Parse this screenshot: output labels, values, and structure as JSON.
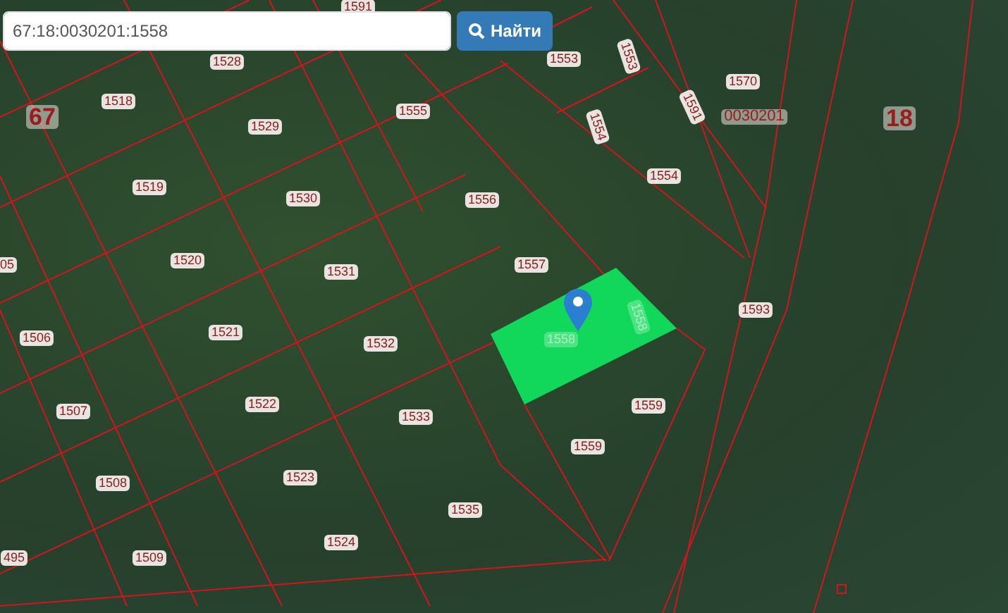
{
  "search": {
    "value": "67:18:0030201:1558",
    "button": "Найти"
  },
  "map_labels": [
    {
      "text": "1591",
      "kind": "parcel"
    },
    {
      "text": "1528",
      "kind": "parcel"
    },
    {
      "text": "67",
      "kind": "district"
    },
    {
      "text": "1518",
      "kind": "parcel"
    },
    {
      "text": "1529",
      "kind": "parcel"
    },
    {
      "text": "1555",
      "kind": "parcel"
    },
    {
      "text": "1553",
      "kind": "parcel"
    },
    {
      "text": "1553",
      "kind": "parcel"
    },
    {
      "text": "1554",
      "kind": "parcel"
    },
    {
      "text": "1591",
      "kind": "parcel"
    },
    {
      "text": "1570",
      "kind": "parcel"
    },
    {
      "text": "0030201",
      "kind": "quarter"
    },
    {
      "text": "18",
      "kind": "district"
    },
    {
      "text": "1554",
      "kind": "parcel"
    },
    {
      "text": "1519",
      "kind": "parcel"
    },
    {
      "text": "1530",
      "kind": "parcel"
    },
    {
      "text": "1556",
      "kind": "parcel"
    },
    {
      "text": "05",
      "kind": "parcel"
    },
    {
      "text": "1520",
      "kind": "parcel"
    },
    {
      "text": "1531",
      "kind": "parcel"
    },
    {
      "text": "1557",
      "kind": "parcel"
    },
    {
      "text": "1593",
      "kind": "parcel"
    },
    {
      "text": "1506",
      "kind": "parcel"
    },
    {
      "text": "1521",
      "kind": "parcel"
    },
    {
      "text": "1532",
      "kind": "parcel"
    },
    {
      "text": "1558",
      "kind": "highlighted"
    },
    {
      "text": "1558",
      "kind": "highlighted"
    },
    {
      "text": "1507",
      "kind": "parcel"
    },
    {
      "text": "1522",
      "kind": "parcel"
    },
    {
      "text": "1533",
      "kind": "parcel"
    },
    {
      "text": "1559",
      "kind": "parcel"
    },
    {
      "text": "1559",
      "kind": "parcel"
    },
    {
      "text": "1508",
      "kind": "parcel"
    },
    {
      "text": "1523",
      "kind": "parcel"
    },
    {
      "text": "1535",
      "kind": "parcel"
    },
    {
      "text": "495",
      "kind": "parcel"
    },
    {
      "text": "1509",
      "kind": "parcel"
    },
    {
      "text": "1524",
      "kind": "parcel"
    }
  ]
}
